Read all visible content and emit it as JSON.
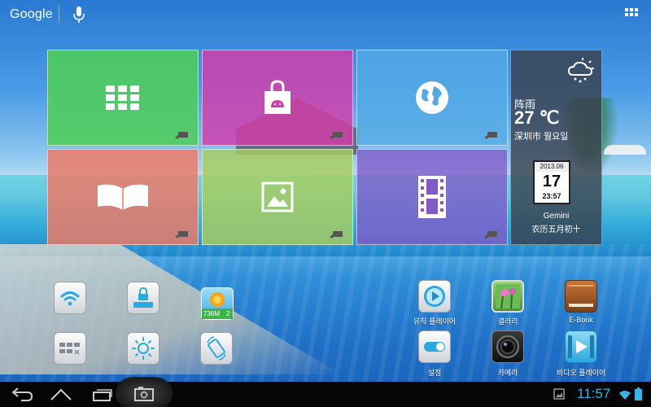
{
  "topbar": {
    "search_label": "Google"
  },
  "tiles": [
    {
      "name": "apps-tile",
      "icon": "grid-icon",
      "color": "#50cd5a"
    },
    {
      "name": "store-tile",
      "icon": "shopping-bag-icon",
      "color": "#d63caa"
    },
    {
      "name": "browser-tile",
      "icon": "globe-icon",
      "color": "#55aae6"
    },
    {
      "name": "ebook-tile",
      "icon": "open-book-icon",
      "color": "#f07864"
    },
    {
      "name": "gallery-tile",
      "icon": "picture-icon",
      "color": "#aacd5a"
    },
    {
      "name": "video-tile",
      "icon": "film-strip-icon",
      "color": "#825ac8"
    }
  ],
  "weather": {
    "condition": "阵雨",
    "temperature": "27 ℃",
    "city": "深圳市 월요일",
    "calendar_month": "2013.06",
    "calendar_day": "17",
    "time": "23:57",
    "star_sign": "Gemini",
    "lunar_date": "农历五月初十"
  },
  "widgets": {
    "memory_text": "736M",
    "memory_count": "2"
  },
  "apps": {
    "music_player": "뮤직 플레이어",
    "gallery": "갤러리",
    "ebook": "E-Book",
    "settings": "설정",
    "camera": "카메라",
    "video_player": "비디오 플레이어"
  },
  "statusbar": {
    "clock": "11:57"
  },
  "colors": {
    "accent": "#33b5e5"
  }
}
